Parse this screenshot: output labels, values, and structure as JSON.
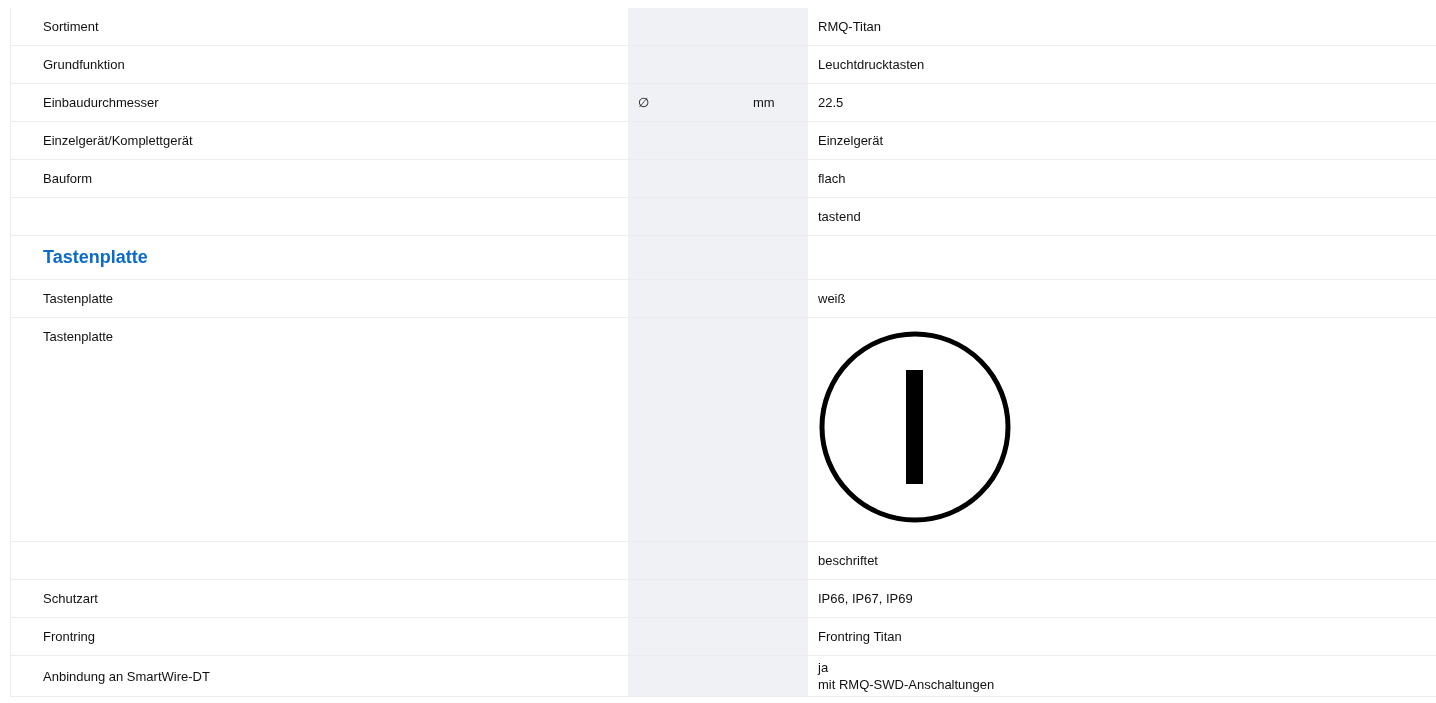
{
  "rows": [
    {
      "kind": "row",
      "label": "Sortiment",
      "value": [
        "RMQ-Titan"
      ]
    },
    {
      "kind": "row",
      "label": "Grundfunktion",
      "value": [
        "Leuchtdrucktasten"
      ]
    },
    {
      "kind": "row",
      "label": "Einbaudurchmesser",
      "symbol": "∅",
      "unit": "mm",
      "value": [
        "22.5"
      ]
    },
    {
      "kind": "row",
      "label": "Einzelgerät/Komplettgerät",
      "value": [
        "Einzelgerät"
      ]
    },
    {
      "kind": "row",
      "label": "Bauform",
      "value": [
        "flach"
      ]
    },
    {
      "kind": "row",
      "value": [
        "tastend"
      ]
    },
    {
      "kind": "heading",
      "label": "Tastenplatte",
      "children": [
        {
          "kind": "row",
          "label": "Tastenplatte",
          "value": [
            "weiß"
          ]
        },
        {
          "kind": "image",
          "label": "Tastenplatte"
        },
        {
          "kind": "row",
          "value": [
            "beschriftet"
          ]
        }
      ]
    },
    {
      "kind": "row",
      "label": "Schutzart",
      "value": [
        "IP66, IP67, IP69"
      ]
    },
    {
      "kind": "row",
      "label": "Frontring",
      "value": [
        "Frontring Titan"
      ]
    },
    {
      "kind": "row",
      "label": "Anbindung an SmartWire-DT",
      "value": [
        "ja",
        "mit RMQ-SWD-Anschaltungen"
      ]
    }
  ]
}
